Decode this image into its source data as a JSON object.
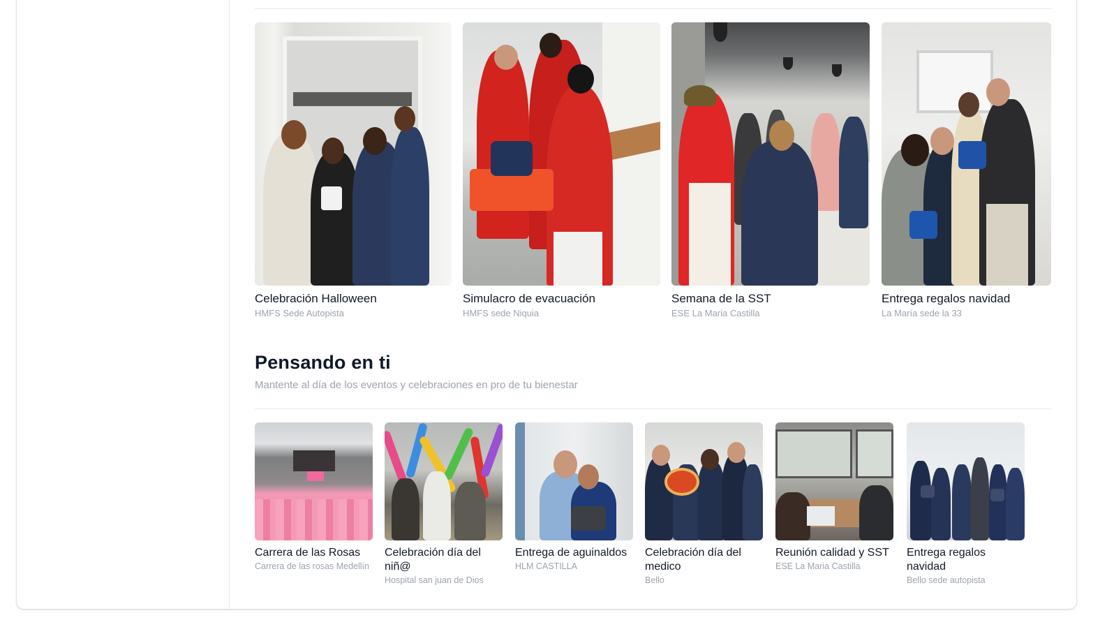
{
  "gallery": {
    "items": [
      {
        "title": "Celebración Halloween",
        "subtitle": "HMFS Sede Autopista"
      },
      {
        "title": "Simulacro de evacuación",
        "subtitle": "HMFS sede Niquia"
      },
      {
        "title": "Semana de la SST",
        "subtitle": "ESE La Maria Castilla"
      },
      {
        "title": "Entrega regalos navidad",
        "subtitle": "La María sede la 33"
      }
    ]
  },
  "pensando": {
    "title": "Pensando en ti",
    "subtitle": "Mantente al día de los eventos y celebraciones en pro de tu bienestar",
    "items": [
      {
        "title": "Carrera de las Rosas",
        "subtitle": "Carrera de las rosas Medellín"
      },
      {
        "title": "Celebración día del niñ@",
        "subtitle": "Hospital san juan de Dios"
      },
      {
        "title": "Entrega de aguinaldos",
        "subtitle": "HLM CASTILLA"
      },
      {
        "title": "Celebración día del medico",
        "subtitle": "Bello"
      },
      {
        "title": "Reunión calidad y SST",
        "subtitle": "ESE La Maria Castilla"
      },
      {
        "title": "Entrega regalos navidad",
        "subtitle": "Bello sede autopista"
      }
    ]
  },
  "colors": {
    "text_primary": "#111827",
    "text_muted": "#9ca3af",
    "divider": "#e5e7eb"
  }
}
